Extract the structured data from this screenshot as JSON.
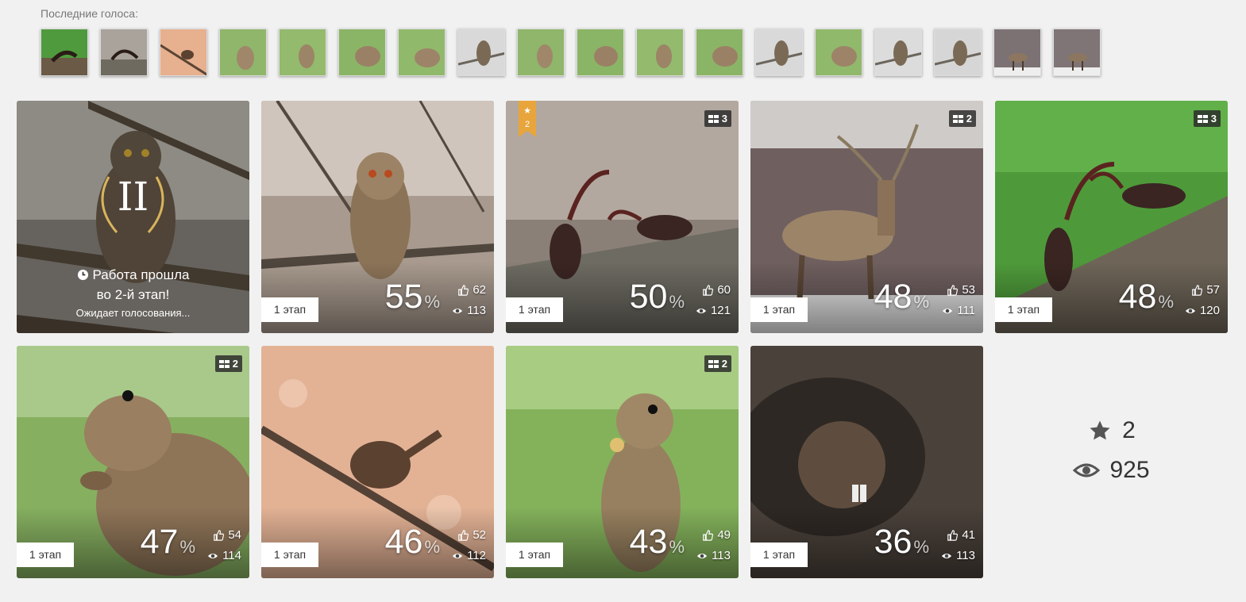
{
  "recent_votes": {
    "title": "Последние голоса:",
    "thumbs": [
      "beetles-green",
      "beetle",
      "wren",
      "gopher",
      "gopher",
      "gopher",
      "gopher",
      "owl",
      "gopher",
      "gopher",
      "gopher",
      "gopher",
      "owl",
      "gopher",
      "owl",
      "owl",
      "deer",
      "deer"
    ]
  },
  "works": [
    {
      "id": "owl-pygmy",
      "status": "passed",
      "stage_roman": "II",
      "passed_line1": "Работа прошла",
      "passed_line2": "во 2-й этап!",
      "waiting": "Ожидает голосования..."
    },
    {
      "id": "owl-long-eared",
      "stage": "1 этап",
      "percent": "55",
      "likes": "62",
      "views": "113"
    },
    {
      "id": "stag-beetles",
      "stage": "1 этап",
      "percent": "50",
      "likes": "60",
      "views": "121",
      "stack": "3",
      "ribbon": "2"
    },
    {
      "id": "deer",
      "stage": "1 этап",
      "percent": "48",
      "likes": "53",
      "views": "111",
      "stack": "2"
    },
    {
      "id": "stag-beetles-green",
      "stage": "1 этап",
      "percent": "48",
      "likes": "57",
      "views": "120",
      "stack": "3"
    },
    {
      "id": "gopher-1",
      "stage": "1 этап",
      "percent": "47",
      "likes": "54",
      "views": "114",
      "stack": "2"
    },
    {
      "id": "wren",
      "stage": "1 этап",
      "percent": "46",
      "likes": "52",
      "views": "112"
    },
    {
      "id": "gopher-2",
      "stage": "1 этап",
      "percent": "43",
      "likes": "49",
      "views": "113",
      "stack": "2"
    },
    {
      "id": "vole",
      "stage": "1 этап",
      "percent": "36",
      "likes": "41",
      "views": "113"
    }
  ],
  "summary": {
    "stars": "2",
    "views": "925"
  },
  "percent_sign": "%",
  "icons": {
    "like": "thumbs-up-icon",
    "view": "eye-icon",
    "stack": "grid-icon",
    "star": "star-icon",
    "clock": "clock-icon"
  }
}
